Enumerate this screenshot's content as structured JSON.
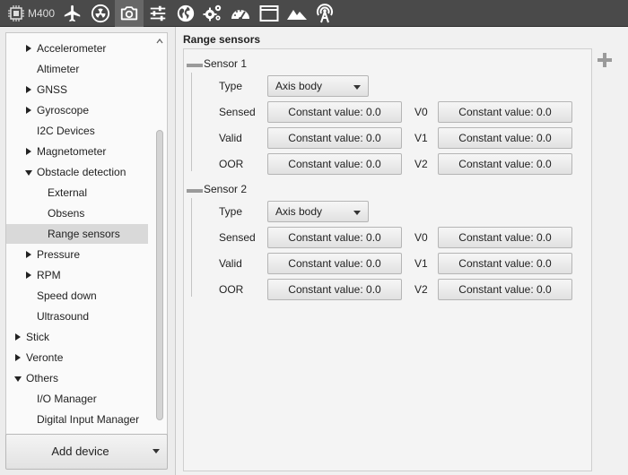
{
  "toolbar": {
    "device_label": "M400",
    "items": [
      {
        "icon": "chip-icon"
      },
      {
        "icon": "plane-icon"
      },
      {
        "icon": "radiation-icon"
      },
      {
        "icon": "camera-icon"
      },
      {
        "icon": "sliders-icon"
      },
      {
        "icon": "globe-icon"
      },
      {
        "icon": "gears-icon"
      },
      {
        "icon": "gauge-icon"
      },
      {
        "icon": "window-icon"
      },
      {
        "icon": "mountain-icon"
      },
      {
        "icon": "antenna-icon"
      }
    ],
    "active_icon": "camera-icon",
    "colors": {
      "bar": "#4a4a4a",
      "active": "#676767",
      "icon": "#ffffff"
    }
  },
  "tree": {
    "items": [
      {
        "label": "Accelerometer",
        "expander": "collapsed",
        "level": 1
      },
      {
        "label": "Altimeter",
        "expander": "none",
        "level": 1
      },
      {
        "label": "GNSS",
        "expander": "collapsed",
        "level": 1
      },
      {
        "label": "Gyroscope",
        "expander": "collapsed",
        "level": 1
      },
      {
        "label": "I2C Devices",
        "expander": "none",
        "level": 1
      },
      {
        "label": "Magnetometer",
        "expander": "collapsed",
        "level": 1
      },
      {
        "label": "Obstacle detection",
        "expander": "expanded",
        "level": 1
      },
      {
        "label": "External",
        "expander": "none",
        "level": 2
      },
      {
        "label": "Obsens",
        "expander": "none",
        "level": 2
      },
      {
        "label": "Range sensors",
        "expander": "none",
        "level": 2,
        "selected": true
      },
      {
        "label": "Pressure",
        "expander": "collapsed",
        "level": 1
      },
      {
        "label": "RPM",
        "expander": "collapsed",
        "level": 1
      },
      {
        "label": "Speed down",
        "expander": "none",
        "level": 1
      },
      {
        "label": "Ultrasound",
        "expander": "none",
        "level": 1
      },
      {
        "label": "Stick",
        "expander": "collapsed",
        "level": 0
      },
      {
        "label": "Veronte",
        "expander": "collapsed",
        "level": 0
      },
      {
        "label": "Others",
        "expander": "expanded",
        "level": 0
      },
      {
        "label": "I/O Manager",
        "expander": "none",
        "level": 1
      },
      {
        "label": "Digital Input Manager",
        "expander": "none",
        "level": 1
      }
    ]
  },
  "left_panel": {
    "add_device_label": "Add device"
  },
  "main": {
    "title": "Range sensors",
    "add_icon": "plus-icon",
    "sensors": [
      {
        "title": "Sensor 1",
        "type_label": "Type",
        "type_value": "Axis body",
        "rows": [
          {
            "label": "Sensed",
            "value": "Constant value: 0.0",
            "v_label": "V0",
            "v_value": "Constant value: 0.0"
          },
          {
            "label": "Valid",
            "value": "Constant value: 0.0",
            "v_label": "V1",
            "v_value": "Constant value: 0.0"
          },
          {
            "label": "OOR",
            "value": "Constant value: 0.0",
            "v_label": "V2",
            "v_value": "Constant value: 0.0"
          }
        ]
      },
      {
        "title": "Sensor 2",
        "type_label": "Type",
        "type_value": "Axis body",
        "rows": [
          {
            "label": "Sensed",
            "value": "Constant value: 0.0",
            "v_label": "V0",
            "v_value": "Constant value: 0.0"
          },
          {
            "label": "Valid",
            "value": "Constant value: 0.0",
            "v_label": "V1",
            "v_value": "Constant value: 0.0"
          },
          {
            "label": "OOR",
            "value": "Constant value: 0.0",
            "v_label": "V2",
            "v_value": "Constant value: 0.0"
          }
        ]
      }
    ]
  }
}
